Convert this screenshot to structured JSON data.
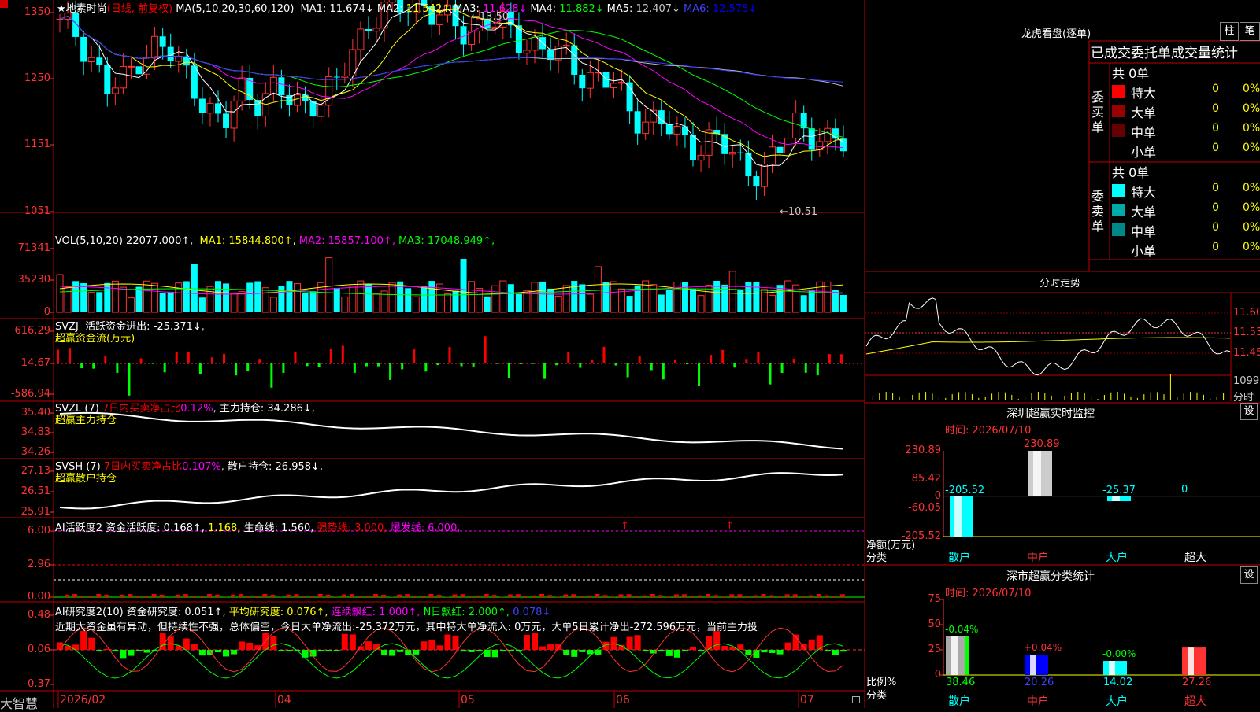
{
  "app": {
    "brand": "大智慧"
  },
  "chart": {
    "title_prefix": "★",
    "stock_name": "地素时尚",
    "period": "(日线, 前复权)",
    "ma_param": "MA(5,10,20,30,60,120)",
    "ma_values": [
      {
        "label": "MA1:",
        "value": "11.674↓",
        "color": "#ffffff"
      },
      {
        "label": "MA2:",
        "value": "11.542↑",
        "color": "#ffff00"
      },
      {
        "label": "MA3:",
        "value": "11.628↓",
        "color": "#ff00ff"
      },
      {
        "label": "MA4:",
        "value": "11.882↓",
        "color": "#00ff00"
      },
      {
        "label": "MA5:",
        "value": "12.407↓",
        "color": "#cccccc"
      },
      {
        "label": "MA6:",
        "value": "12.575↓",
        "color": "#0000ff"
      }
    ],
    "price_ticks": [
      "1350",
      "1250",
      "1151",
      "1051"
    ],
    "high_label": "13.50",
    "low_label": "10.51",
    "dates": [
      "2026/02",
      "04",
      "05",
      "06",
      "07"
    ]
  },
  "vol": {
    "header": "VOL(5,10,20)",
    "value": "22077.000↑",
    "ma": [
      {
        "label": "MA1:",
        "value": "15844.800↑",
        "color": "#ffff00"
      },
      {
        "label": "MA2:",
        "value": "15857.100↑",
        "color": "#ff00ff"
      },
      {
        "label": "MA3:",
        "value": "17048.949↑",
        "color": "#00ff00"
      }
    ],
    "ticks": [
      "71341",
      "35230",
      "0"
    ]
  },
  "svzj": {
    "header": "SVZJ",
    "label": "活跃资金进出:",
    "value": "-25.371↓",
    "sub": "超赢资金流(万元)",
    "ticks": [
      "616.29",
      "14.67",
      "-586.94"
    ]
  },
  "svzl": {
    "header": "SVZL (7)",
    "label": "7日内买卖净占比",
    "pct": "0.12%",
    "label2": "主力持仓:",
    "value": "34.286↓,",
    "sub": "超赢主力持仓",
    "ticks": [
      "35.40",
      "34.83",
      "34.26"
    ]
  },
  "svsh": {
    "header": "SVSH (7)",
    "label": "7日内买卖净占比",
    "pct": "0.107%",
    "label2": "散户持仓:",
    "value": "26.958↓,",
    "sub": "超赢散户持仓",
    "ticks": [
      "27.13",
      "26.51",
      "25.91"
    ]
  },
  "ai_active": {
    "header": "AI活跃度2",
    "label": "资金活跃度:",
    "v1": "0.168↑,",
    "v2": "1.168,",
    "life_label": "生命线:",
    "life": "1.560,",
    "strong": "强势线: 3.000,",
    "burst": "爆发线: 6.000,",
    "ticks": [
      "6.00",
      "2.96",
      "0.00"
    ]
  },
  "ai_research": {
    "header": "AI研究度2(10)",
    "label": "资金研究度:",
    "v1": "0.051↑,",
    "avg": "平均研究度: 0.076↑,",
    "red": "连续飘红: 1.000↑,",
    "nred": "N日飘红: 2.000↑,",
    "last": "0.078↓",
    "comment": "近期大资金虽有异动，但持续性不强，总体偏空，今日大单净流出:-25.372万元，其中特大单净流入: 0万元，大单5日累计净出-272.596万元，当前主力投",
    "ticks": [
      "0.48",
      "0.06",
      "-0.37"
    ]
  },
  "dragon": {
    "title": "龙虎看盘(逐单)",
    "btn_zhu": "柱",
    "btn_bi": "笔",
    "tabs": [
      "已成交",
      "委托单",
      "成交量统计"
    ],
    "buy_label": "委买单",
    "sell_label": "委卖单",
    "buy_total": "共 0单",
    "sell_total": "共 0单",
    "rows": [
      "特大",
      "大单",
      "中单",
      "小单"
    ],
    "buy_colors": [
      "#ff0000",
      "#990000",
      "#660000",
      "#000000"
    ],
    "sell_colors": [
      "#00ffff",
      "#00aaaa",
      "#008888",
      "#000000"
    ],
    "zero": "0",
    "pct": "0%"
  },
  "intraday": {
    "title": "分时走势",
    "ticks": [
      "11.60",
      "11.53",
      "11.45"
    ],
    "vol_tick": "1099",
    "vol_label": "分时"
  },
  "sz_monitor": {
    "title": "深圳超赢实时监控",
    "btn": "设",
    "time": "时间: 2026/07/10",
    "ticks": [
      "230.89",
      "85.42",
      "0",
      "-60.05",
      "-205.52"
    ],
    "ylabel": "净额(万元)",
    "xlabel": "分类",
    "categories": [
      "散户",
      "中户",
      "大户",
      "超大"
    ],
    "value_labels": [
      "-205.52",
      "230.89",
      "-25.37",
      "0"
    ]
  },
  "sz_stats": {
    "title": "深市超赢分类统计",
    "btn": "设",
    "time": "时间: 2026/07/10",
    "ticks": [
      "75",
      "50",
      "25",
      "0"
    ],
    "ylabel": "比例%",
    "xlabel": "分类",
    "categories": [
      "散户",
      "中户",
      "大户",
      "超大"
    ],
    "change_labels": [
      "-0.04%",
      "+0.04%",
      "-0.00%",
      ""
    ],
    "value_labels": [
      "38.46",
      "20.26",
      "14.02",
      "27.26"
    ]
  },
  "chart_data": [
    {
      "type": "bar",
      "title": "深圳超赢实时监控",
      "ylabel": "净额(万元)",
      "xlabel": "分类",
      "categories": [
        "散户",
        "中户",
        "大户",
        "超大"
      ],
      "values": [
        -205.52,
        230.89,
        -25.37,
        0
      ],
      "ylim": [
        -205.52,
        230.89
      ]
    },
    {
      "type": "bar",
      "title": "深市超赢分类统计",
      "ylabel": "比例%",
      "xlabel": "分类",
      "categories": [
        "散户",
        "中户",
        "大户",
        "超大"
      ],
      "values": [
        38.46,
        20.26,
        14.02,
        27.26
      ],
      "ylim": [
        0,
        75
      ]
    }
  ]
}
